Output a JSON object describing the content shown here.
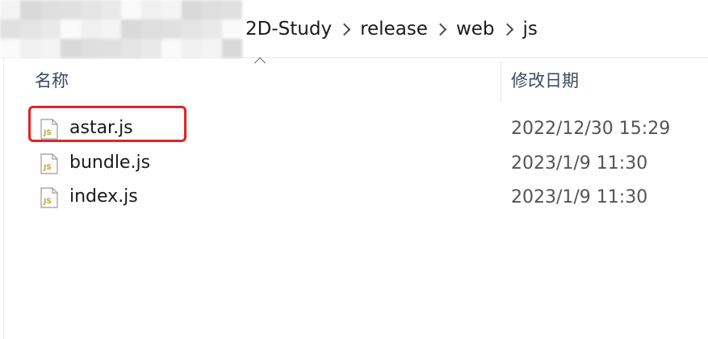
{
  "address_bar": {
    "breadcrumbs": [
      "2D-Study",
      "release",
      "web",
      "js"
    ]
  },
  "columns": {
    "name_label": "名称",
    "modified_label": "修改日期"
  },
  "files": [
    {
      "name": "astar.js",
      "modified": "2022/12/30 15:29",
      "icon": "js-file-icon",
      "highlighted": true
    },
    {
      "name": "bundle.js",
      "modified": "2023/1/9 11:30",
      "icon": "js-file-icon",
      "highlighted": false
    },
    {
      "name": "index.js",
      "modified": "2023/1/9 11:30",
      "icon": "js-file-icon",
      "highlighted": false
    }
  ],
  "colors": {
    "highlight": "#e8211f",
    "js_icon": "#b7a83a"
  }
}
